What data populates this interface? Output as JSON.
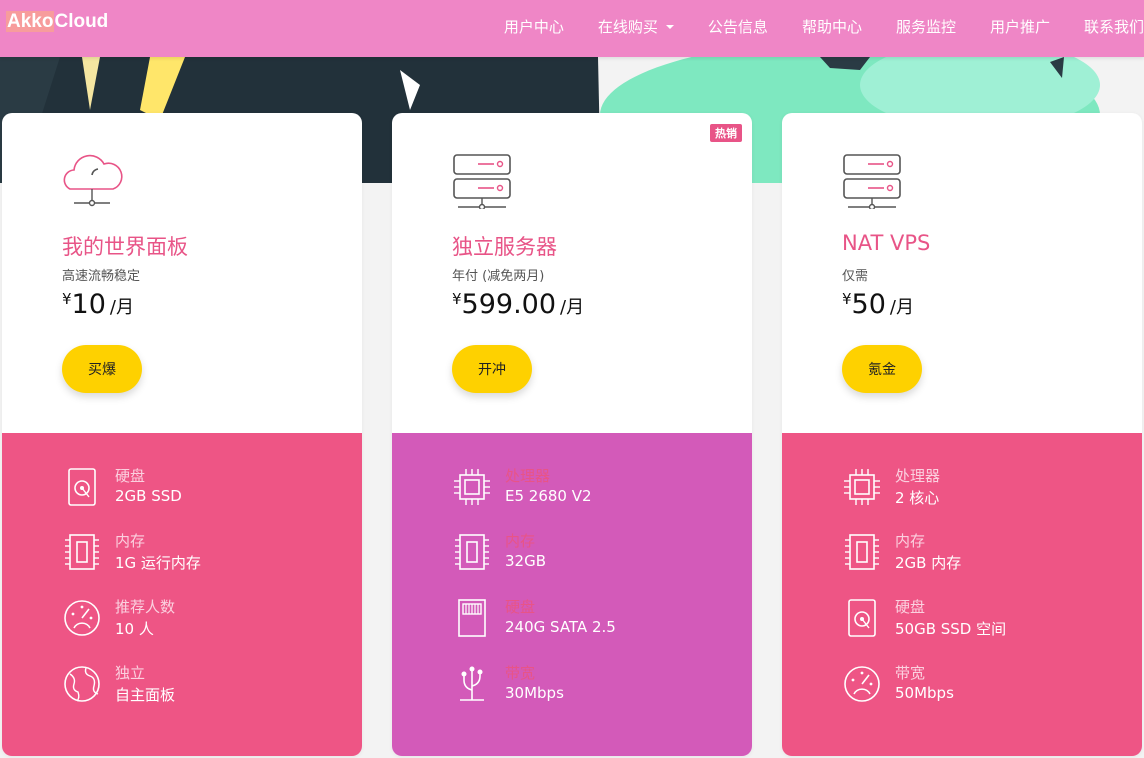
{
  "brand": {
    "part1": "Akko",
    "part2": "Cloud"
  },
  "nav": [
    {
      "label": "用户中心",
      "dropdown": false
    },
    {
      "label": "在线购买",
      "dropdown": true
    },
    {
      "label": "公告信息",
      "dropdown": false
    },
    {
      "label": "帮助中心",
      "dropdown": false
    },
    {
      "label": "服务监控",
      "dropdown": false
    },
    {
      "label": "用户推广",
      "dropdown": false
    },
    {
      "label": "联系我们",
      "dropdown": false
    }
  ],
  "colors": {
    "nav": "#ef86c6",
    "accent": "#e85487",
    "button": "#fed100",
    "panel_pink": "#ee5585",
    "panel_purple": "#d35ab9"
  },
  "cards": [
    {
      "icon": "cloud-icon",
      "title": "我的世界面板",
      "subtitle": "高速流畅稳定",
      "currency": "¥",
      "price": "10",
      "period": "/月",
      "button": "买爆",
      "badge": "",
      "features": [
        {
          "icon": "disk-icon",
          "label": "硬盘",
          "value": "2GB SSD"
        },
        {
          "icon": "memory-icon",
          "label": "内存",
          "value": "1G 运行内存"
        },
        {
          "icon": "gauge-icon",
          "label": "推荐人数",
          "value": "10 人"
        },
        {
          "icon": "globe-icon",
          "label": "独立",
          "value": "自主面板"
        }
      ]
    },
    {
      "icon": "server-icon",
      "title": "独立服务器",
      "subtitle": "年付 (减免两月)",
      "currency": "¥",
      "price": "599.00",
      "period": "/月",
      "button": "开冲",
      "badge": "热销",
      "features": [
        {
          "icon": "cpu-icon",
          "label": "处理器",
          "value": "E5 2680 V2"
        },
        {
          "icon": "memory-icon",
          "label": "内存",
          "value": "32GB"
        },
        {
          "icon": "sd-card-icon",
          "label": "硬盘",
          "value": "240G SATA 2.5"
        },
        {
          "icon": "network-icon",
          "label": "带宽",
          "value": "30Mbps"
        }
      ]
    },
    {
      "icon": "server-icon",
      "title": "NAT VPS",
      "subtitle": "仅需",
      "currency": "¥",
      "price": "50",
      "period": "/月",
      "button": "氪金",
      "badge": "",
      "features": [
        {
          "icon": "cpu-icon",
          "label": "处理器",
          "value": "2 核心"
        },
        {
          "icon": "memory-icon",
          "label": "内存",
          "value": "2GB 内存"
        },
        {
          "icon": "disk-icon",
          "label": "硬盘",
          "value": "50GB SSD 空间"
        },
        {
          "icon": "gauge-icon",
          "label": "带宽",
          "value": "50Mbps"
        }
      ]
    }
  ]
}
